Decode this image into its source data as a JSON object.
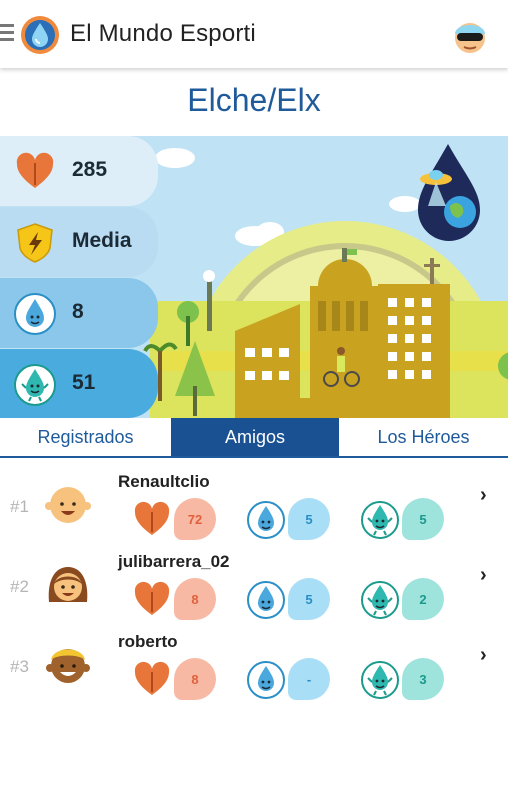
{
  "app": {
    "title": "El Mundo Esporti"
  },
  "city": {
    "name": "Elche/Elx"
  },
  "stats": [
    {
      "icon": "heart-icon",
      "value": "285"
    },
    {
      "icon": "shield-lightning-icon",
      "value": "Media"
    },
    {
      "icon": "water-drop-face-icon",
      "value": "8"
    },
    {
      "icon": "water-drop-character-icon",
      "value": "51"
    }
  ],
  "tabs": [
    {
      "label": "Registrados",
      "active": false
    },
    {
      "label": "Amigos",
      "active": true
    },
    {
      "label": "Los Héroes",
      "active": false
    }
  ],
  "ranking": [
    {
      "rank": "#1",
      "username": "Renaultclio",
      "hearts": "72",
      "drops": "5",
      "heroes": "5",
      "avatar": "bald-boy-avatar"
    },
    {
      "rank": "#2",
      "username": "julibarrera_02",
      "hearts": "8",
      "drops": "5",
      "heroes": "2",
      "avatar": "girl-brown-hair-avatar"
    },
    {
      "rank": "#3",
      "username": "roberto",
      "hearts": "8",
      "drops": "-",
      "heroes": "3",
      "avatar": "blond-boy-avatar"
    }
  ],
  "colors": {
    "primary": "#1a5192",
    "heart": "#e8763a",
    "orange_bubble": "#f7b9a3",
    "blue_bubble": "#a8dff6",
    "teal_bubble": "#9ee3dc"
  }
}
